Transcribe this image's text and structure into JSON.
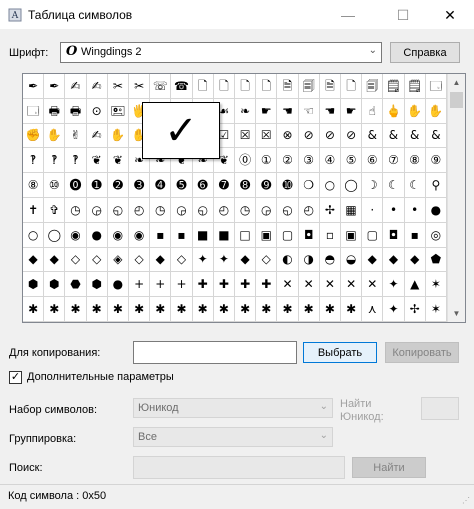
{
  "window": {
    "title": "Таблица символов",
    "minimize_glyph": "—",
    "maximize_glyph": "☐",
    "close_glyph": "✕"
  },
  "font_row": {
    "label": "Шрифт:",
    "font_icon_glyph": "O",
    "value": "Wingdings 2",
    "arrow": "⌄",
    "help_button": "Справка"
  },
  "grid": {
    "cols": 20,
    "rows": 10,
    "selected_glyph": "✓",
    "chars": [
      "✒",
      "✒",
      "✍",
      "✍",
      "✂",
      "✂",
      "☏",
      "☎",
      "🗋",
      "🗋",
      "🗋",
      "🗋",
      "🗎",
      "🗐",
      "🗎",
      "🗋",
      "🗐",
      "🗒",
      "🗒",
      "🗔",
      "🗔",
      "🖶",
      "🖶",
      "⊙",
      "🖭",
      "🖐",
      "🖐",
      "☙",
      "❧",
      "☙",
      "❧",
      "☛",
      "☚",
      "☜",
      "☚",
      "☛",
      "☝",
      "🖕",
      "✋",
      "✋",
      "✊",
      "✋",
      "✌",
      "✍",
      "✋",
      "✋",
      "✓",
      "✓",
      "☒",
      "☑",
      "☒",
      "☒",
      "⊗",
      "⊘",
      "⊘",
      "⊘",
      "&",
      "&",
      "&",
      "&",
      "‽",
      "‽",
      "‽",
      "❦",
      "❦",
      "❧",
      "❧",
      "❦",
      "❧",
      "❦",
      "⓪",
      "①",
      "②",
      "③",
      "④",
      "⑤",
      "⑥",
      "⑦",
      "⑧",
      "⑨",
      "⑧",
      "⑩",
      "⓿",
      "➊",
      "➋",
      "➌",
      "➍",
      "➎",
      "➏",
      "➐",
      "➑",
      "➒",
      "➓",
      "❍",
      "○",
      "◯",
      "☽",
      "☾",
      "☾",
      "⚲",
      "✝",
      "✞",
      "◷",
      "◶",
      "◵",
      "◴",
      "◷",
      "◶",
      "◵",
      "◴",
      "◷",
      "◶",
      "◵",
      "◴",
      "✢",
      "▦",
      "·",
      "•",
      "•",
      "●",
      "○",
      "◯",
      "◉",
      "●",
      "◉",
      "◉",
      "▪",
      "▪",
      "■",
      "■",
      "□",
      "▣",
      "▢",
      "◘",
      "▫",
      "▣",
      "▢",
      "◘",
      "▪",
      "◎",
      "◆",
      "◆",
      "◇",
      "◇",
      "◈",
      "◇",
      "◆",
      "◇",
      "✦",
      "✦",
      "◆",
      "◇",
      "◐",
      "◑",
      "◓",
      "◒",
      "◆",
      "◆",
      "◆",
      "⬟",
      "⬢",
      "⬢",
      "⬣",
      "⬢",
      "●",
      "+",
      "+",
      "+",
      "✚",
      "✚",
      "✚",
      "✚",
      "✕",
      "✕",
      "✕",
      "✕",
      "✕",
      "✦",
      "▲",
      "✶",
      "✱",
      "✱",
      "✱",
      "✱",
      "✱",
      "✱",
      "✱",
      "✱",
      "✱",
      "✱",
      "✱",
      "✱",
      "✱",
      "✱",
      "✱",
      "✱",
      "⋏",
      "✦",
      "✢",
      "✶"
    ]
  },
  "copy_row": {
    "label": "Для копирования:",
    "value": "",
    "select_button": "Выбрать",
    "copy_button": "Копировать"
  },
  "advanced": {
    "checkbox_label": "Дополнительные параметры",
    "checked": true,
    "check_glyph": "✓",
    "charset_label": "Набор символов:",
    "charset_value": "Юникод",
    "find_unicode_label_1": "Найти",
    "find_unicode_label_2": "Юникод:",
    "grouping_label": "Группировка:",
    "grouping_value": "Все",
    "search_label": "Поиск:",
    "find_button": "Найти"
  },
  "status": {
    "text": "Код символа : 0x50"
  }
}
